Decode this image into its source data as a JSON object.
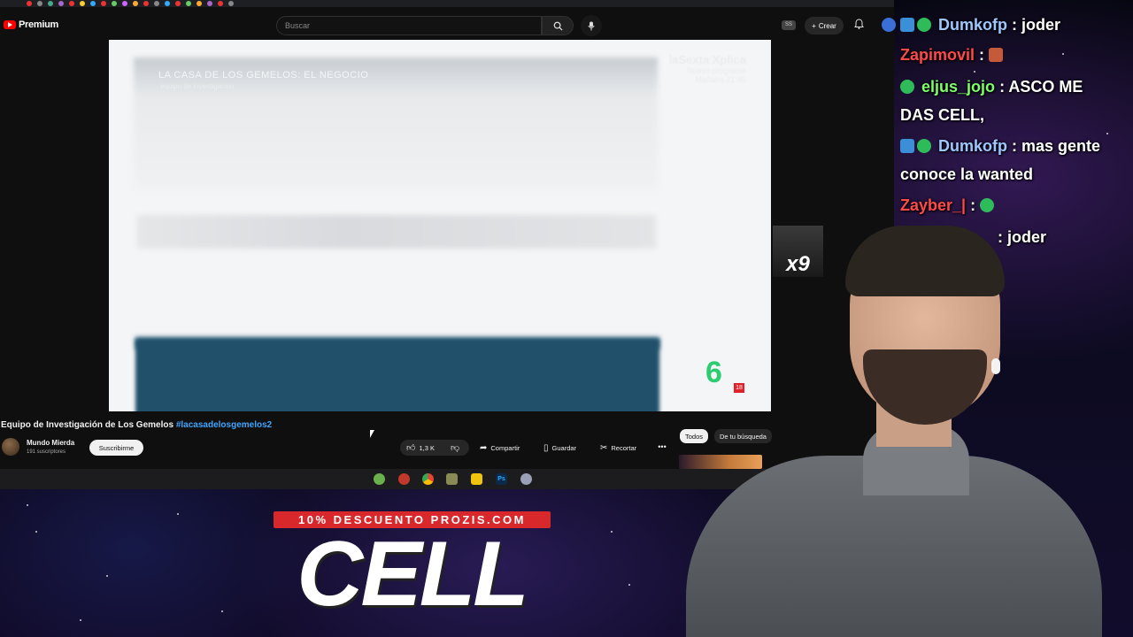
{
  "youtube": {
    "logo_text": "Premium",
    "search_placeholder": "Buscar",
    "avatar_badge": "SS",
    "create_label": "Crear"
  },
  "video": {
    "overlay_title": "LA CASA DE LOS GEMELOS: EL NEGOCIO",
    "overlay_subtitle": "equipo de investigación",
    "watermark_line1": "laSexta Xplica",
    "watermark_line2": "Nuevo programa",
    "watermark_line3": "Mañana 21:45",
    "channel_logo": "6",
    "age_rating": "18",
    "title": "Equipo de Investigación de Los Gemelos",
    "hashtag": "#lacasadelosgemelos2",
    "channel_name": "Mundo Mierda",
    "subscribers": "191 suscriptores",
    "subscribe_label": "Suscribirme",
    "likes": "1,3 K",
    "share_label": "Compartir",
    "save_label": "Guardar",
    "clip_label": "Recortar"
  },
  "sidebar_chips": {
    "all": "Todos",
    "from_search": "De tu búsqueda"
  },
  "multiplier": "x9",
  "chat": [
    {
      "user": "Dumkofp",
      "text": ": joder",
      "user_color": "#9fc7ff",
      "badges": [
        "blue",
        "green"
      ]
    },
    {
      "user": "Zapimovil",
      "text": ":",
      "user_color": "#ff4a4a",
      "badges": [],
      "emote": true
    },
    {
      "user": "eljus_jojo",
      "text": ": ASCO ME",
      "user_color": "#7dff6a",
      "badges": [
        "green"
      ]
    },
    {
      "user": "",
      "text": "DAS CELL,",
      "user_color": "#ffffff",
      "badges": []
    },
    {
      "user": "Dumkofp",
      "text": ": mas gente",
      "user_color": "#9fc7ff",
      "badges": [
        "blue",
        "green"
      ]
    },
    {
      "user": "",
      "text": "conoce la wanted",
      "user_color": "#ffffff",
      "badges": []
    },
    {
      "user": "Zayber_|",
      "text": ":",
      "user_color": "#ff4a4a",
      "badges": [],
      "emote": true
    },
    {
      "user": "",
      "text": ": joder",
      "user_color": "#ffffff",
      "badges": []
    }
  ],
  "promo": {
    "banner": "10% DESCUENTO PROZIS.COM",
    "name": "CELL"
  }
}
